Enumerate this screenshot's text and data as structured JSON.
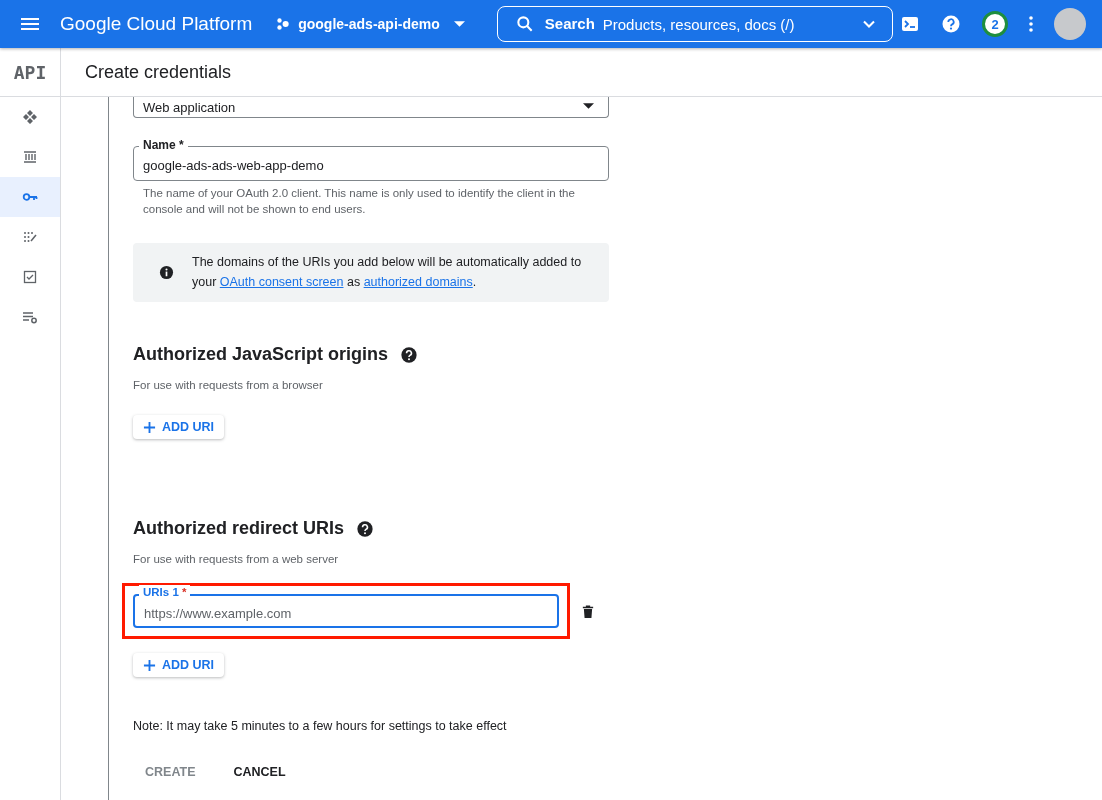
{
  "topbar": {
    "product": "Google Cloud Platform",
    "project": "google-ads-api-demo",
    "search": {
      "label": "Search",
      "placeholder": "Products, resources, docs (/)"
    },
    "notifications": "2"
  },
  "sidebar": {
    "logo": "API",
    "items": [
      {
        "kind": "dashboard",
        "selected": false
      },
      {
        "kind": "library",
        "selected": false
      },
      {
        "kind": "credentials",
        "selected": true
      },
      {
        "kind": "consent",
        "selected": false
      },
      {
        "kind": "agreements",
        "selected": false
      },
      {
        "kind": "settings",
        "selected": false
      }
    ]
  },
  "page_title": "Create credentials",
  "form": {
    "application_type": {
      "value": "Web application"
    },
    "name": {
      "label": "Name *",
      "value": "google-ads-ads-web-app-demo",
      "helper": "The name of your OAuth 2.0 client. This name is only used to identify the client in the console and will not be shown to end users."
    },
    "info": {
      "text": "The domains of the URIs you add below will be automatically added to your",
      "link1": "OAuth consent screen",
      "middle": "as",
      "link2": "authorized domains",
      "end": "."
    },
    "sections": [
      {
        "title": "Authorized JavaScript origins",
        "subtitle": "For use with requests from a browser",
        "add_button": "ADD URI"
      },
      {
        "title": "Authorized redirect URIs",
        "subtitle": "For use with requests from a web server",
        "uris": [
          {
            "label": "URIs 1",
            "required": "*",
            "placeholder": "https://www.example.com",
            "focused": true,
            "highlighted": true
          }
        ],
        "add_button": "ADD URI"
      }
    ],
    "note": "Note: It may take 5 minutes to a few hours for settings to take effect",
    "buttons": [
      {
        "label": "CREATE",
        "disabled": true
      },
      {
        "label": "CANCEL",
        "disabled": false
      }
    ]
  }
}
